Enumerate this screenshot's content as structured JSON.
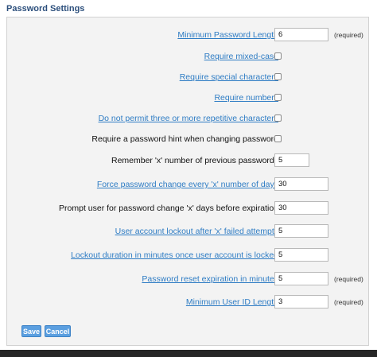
{
  "page": {
    "title": "Password Settings"
  },
  "form": {
    "min_length": {
      "label": "Minimum Password Length",
      "value": "6",
      "note": "(required)"
    },
    "mixed_case": {
      "label": "Require mixed-case",
      "checked": false
    },
    "special_chars": {
      "label": "Require special characters",
      "checked": false
    },
    "numbers": {
      "label": "Require numbers",
      "checked": false
    },
    "no_repeat": {
      "label": "Do not permit three or more repetitive characters",
      "checked": false
    },
    "hint": {
      "label": "Require a password hint when changing password",
      "checked": false
    },
    "remember": {
      "label": "Remember 'x' number of previous passwords",
      "value": "5"
    },
    "force_change": {
      "label": "Force password change every 'x' number of days",
      "value": "30"
    },
    "prompt_change": {
      "label": "Prompt user for password change 'x' days before expiration",
      "value": "30"
    },
    "lockout_attempts": {
      "label": "User account lockout after 'x' failed attempts",
      "value": "5"
    },
    "lockout_duration": {
      "label": "Lockout duration in minutes once user account is locked",
      "value": "5"
    },
    "reset_expiration": {
      "label": "Password reset expiration in minutes",
      "value": "5",
      "note": "(required)"
    },
    "min_userid": {
      "label": "Minimum User ID Length",
      "value": "3",
      "note": "(required)"
    }
  },
  "actions": {
    "save_label": "Save",
    "cancel_label": "Cancel"
  },
  "colors": {
    "link": "#2e7cc4",
    "button": "#5b9fe0",
    "title": "#2c4f7c"
  }
}
